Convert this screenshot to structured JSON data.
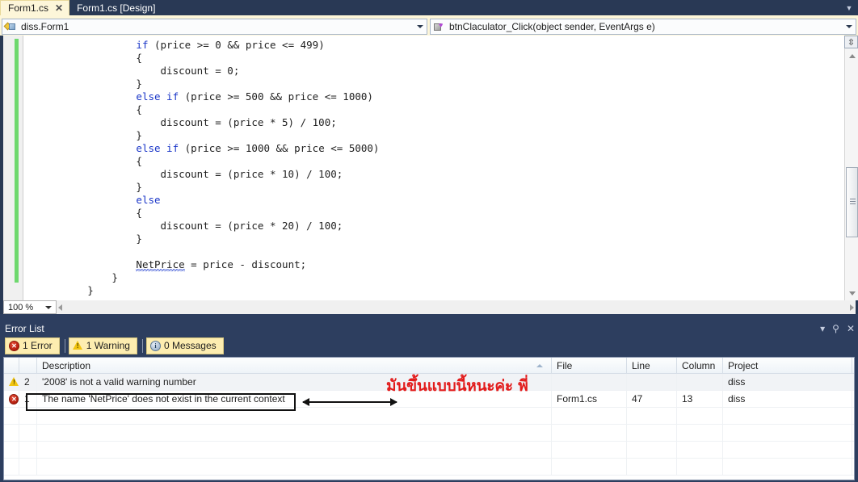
{
  "window": {
    "theme_accent": "#293955",
    "tab_active_bg": "#fdf6d9"
  },
  "tabs": {
    "items": [
      {
        "label": "Form1.cs",
        "active": true,
        "close_glyph": "✕"
      },
      {
        "label": "Form1.cs [Design]",
        "active": false
      }
    ],
    "dropdown_glyph": "▼"
  },
  "navbar": {
    "class_combo": {
      "value": "diss.Form1",
      "icon": "class-icon",
      "arrow_glyph": "▼"
    },
    "member_combo": {
      "value": "btnClaculator_Click(object sender, EventArgs e)",
      "icon": "method-icon",
      "arrow_glyph": "▼"
    }
  },
  "editor": {
    "zoom_level": "100 %",
    "zoom_arrow_glyph": "▼",
    "splitter_glyph": "⇳",
    "code_lines": [
      {
        "indent": 16,
        "segments": [
          {
            "t": "if",
            "c": "kw"
          },
          {
            "t": " (price >= 0 && price <= 499)",
            "c": ""
          }
        ]
      },
      {
        "indent": 16,
        "segments": [
          {
            "t": "{",
            "c": ""
          }
        ]
      },
      {
        "indent": 20,
        "segments": [
          {
            "t": "discount = 0;",
            "c": ""
          }
        ]
      },
      {
        "indent": 16,
        "segments": [
          {
            "t": "}",
            "c": ""
          }
        ]
      },
      {
        "indent": 16,
        "segments": [
          {
            "t": "else if",
            "c": "kw"
          },
          {
            "t": " (price >= 500 && price <= 1000)",
            "c": ""
          }
        ]
      },
      {
        "indent": 16,
        "segments": [
          {
            "t": "{",
            "c": ""
          }
        ]
      },
      {
        "indent": 20,
        "segments": [
          {
            "t": "discount = (price * 5) / 100;",
            "c": ""
          }
        ]
      },
      {
        "indent": 16,
        "segments": [
          {
            "t": "}",
            "c": ""
          }
        ]
      },
      {
        "indent": 16,
        "segments": [
          {
            "t": "else if",
            "c": "kw"
          },
          {
            "t": " (price >= 1000 && price <= 5000)",
            "c": ""
          }
        ]
      },
      {
        "indent": 16,
        "segments": [
          {
            "t": "{",
            "c": ""
          }
        ]
      },
      {
        "indent": 20,
        "segments": [
          {
            "t": "discount = (price * 10) / 100;",
            "c": ""
          }
        ]
      },
      {
        "indent": 16,
        "segments": [
          {
            "t": "}",
            "c": ""
          }
        ]
      },
      {
        "indent": 16,
        "segments": [
          {
            "t": "else",
            "c": "kw"
          }
        ]
      },
      {
        "indent": 16,
        "segments": [
          {
            "t": "{",
            "c": ""
          }
        ]
      },
      {
        "indent": 20,
        "segments": [
          {
            "t": "discount = (price * 20) / 100;",
            "c": ""
          }
        ]
      },
      {
        "indent": 16,
        "segments": [
          {
            "t": "}",
            "c": ""
          }
        ]
      },
      {
        "indent": 0,
        "segments": []
      },
      {
        "indent": 16,
        "segments": [
          {
            "t": "NetPrice",
            "c": "err"
          },
          {
            "t": " = price - discount;",
            "c": ""
          }
        ]
      },
      {
        "indent": 12,
        "segments": [
          {
            "t": "}",
            "c": ""
          }
        ]
      },
      {
        "indent": 8,
        "segments": [
          {
            "t": "}",
            "c": ""
          }
        ]
      }
    ]
  },
  "error_list": {
    "title": "Error List",
    "window_controls": {
      "dropdown": "▾",
      "pin": "⚲",
      "close": "✕"
    },
    "filters": [
      {
        "icon": "error-icon",
        "label": "1 Error"
      },
      {
        "icon": "warning-icon",
        "label": "1 Warning"
      },
      {
        "icon": "info-icon",
        "label": "0 Messages"
      }
    ],
    "columns": [
      {
        "key": "icon",
        "label": ""
      },
      {
        "key": "num",
        "label": ""
      },
      {
        "key": "description",
        "label": "Description",
        "sorted": "asc"
      },
      {
        "key": "file",
        "label": "File"
      },
      {
        "key": "line",
        "label": "Line"
      },
      {
        "key": "column",
        "label": "Column"
      },
      {
        "key": "project",
        "label": "Project"
      }
    ],
    "rows": [
      {
        "icon": "warning-icon",
        "num": "2",
        "description": "'2008' is not a valid warning number",
        "file": "",
        "line": "",
        "column": "",
        "project": "diss"
      },
      {
        "icon": "error-icon",
        "num": "1",
        "description": "The name 'NetPrice' does not exist in the current context",
        "file": "Form1.cs",
        "line": "47",
        "column": "13",
        "project": "diss"
      }
    ],
    "empty_row_count": 4
  },
  "annotation": {
    "thai_note": "มันขึ้นแบบนี้หนะค่ะ พี่",
    "note_color": "#e21b1b",
    "highlight_color": "#111111"
  }
}
